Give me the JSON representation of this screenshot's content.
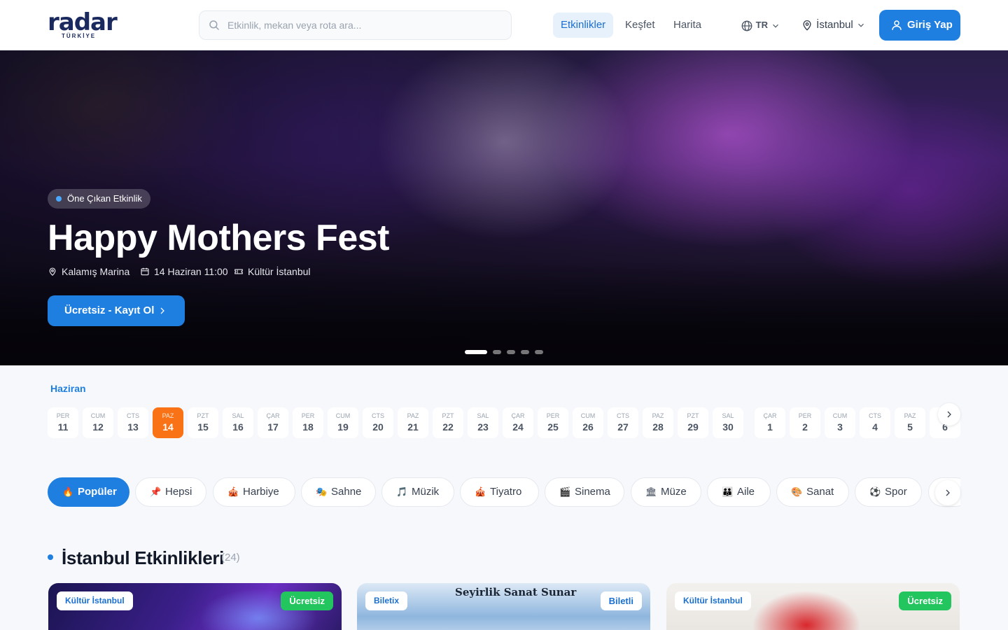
{
  "header": {
    "logo": {
      "word": "radar",
      "sub": "TÜRKİYE"
    },
    "search": {
      "placeholder": "Etkinlik, mekan veya rota ara..."
    },
    "nav": [
      {
        "label": "Etkinlikler",
        "active": true
      },
      {
        "label": "Keşfet",
        "active": false
      },
      {
        "label": "Harita",
        "active": false
      }
    ],
    "lang": "TR",
    "city": "İstanbul",
    "login_label": "Giriş Yap"
  },
  "hero": {
    "badge": "Öne Çıkan Etkinlik",
    "title": "Happy Mothers Fest",
    "venue": "Kalamış Marina",
    "datetime": "14 Haziran 11:00",
    "organizer": "Kültür İstanbul",
    "cta_label": "Ücretsiz - Kayıt Ol",
    "slides_total": 5,
    "slide_active": 1
  },
  "calendar": {
    "month": "Haziran",
    "selected_index": 3,
    "days": [
      {
        "dn": "PER",
        "dd": "11"
      },
      {
        "dn": "CUM",
        "dd": "12"
      },
      {
        "dn": "CTS",
        "dd": "13"
      },
      {
        "dn": "PAZ",
        "dd": "14"
      },
      {
        "dn": "PZT",
        "dd": "15"
      },
      {
        "dn": "SAL",
        "dd": "16"
      },
      {
        "dn": "ÇAR",
        "dd": "17"
      },
      {
        "dn": "PER",
        "dd": "18"
      },
      {
        "dn": "CUM",
        "dd": "19"
      },
      {
        "dn": "CTS",
        "dd": "20"
      },
      {
        "dn": "PAZ",
        "dd": "21"
      },
      {
        "dn": "PZT",
        "dd": "22"
      },
      {
        "dn": "SAL",
        "dd": "23"
      },
      {
        "dn": "ÇAR",
        "dd": "24"
      },
      {
        "dn": "PER",
        "dd": "25"
      },
      {
        "dn": "CUM",
        "dd": "26"
      },
      {
        "dn": "CTS",
        "dd": "27"
      },
      {
        "dn": "PAZ",
        "dd": "28"
      },
      {
        "dn": "PZT",
        "dd": "29"
      },
      {
        "dn": "SAL",
        "dd": "30"
      },
      {
        "dn": "ÇAR",
        "dd": "1"
      },
      {
        "dn": "PER",
        "dd": "2"
      },
      {
        "dn": "CUM",
        "dd": "3"
      },
      {
        "dn": "CTS",
        "dd": "4"
      },
      {
        "dn": "PAZ",
        "dd": "5"
      },
      {
        "dn": "PZT",
        "dd": "6"
      }
    ]
  },
  "categories": [
    {
      "emoji": "🔥",
      "label": "Popüler",
      "active": true
    },
    {
      "emoji": "📌",
      "label": "Hepsi",
      "active": false
    },
    {
      "emoji": "🎪",
      "label": "Harbiye",
      "active": false
    },
    {
      "emoji": "🎭",
      "label": "Sahne",
      "active": false
    },
    {
      "emoji": "🎵",
      "label": "Müzik",
      "active": false
    },
    {
      "emoji": "🎪",
      "label": "Tiyatro",
      "active": false
    },
    {
      "emoji": "🎬",
      "label": "Sinema",
      "active": false
    },
    {
      "emoji": "🏛",
      "label": "Müze",
      "active": false
    },
    {
      "emoji": "👪",
      "label": "Aile",
      "active": false
    },
    {
      "emoji": "🎨",
      "label": "Sanat",
      "active": false
    },
    {
      "emoji": "⚽",
      "label": "Spor",
      "active": false
    }
  ],
  "section": {
    "title": "İstanbul Etkinlikleri",
    "count": "(24)"
  },
  "cards": [
    {
      "source": "Kültür İstanbul",
      "price": "Ücretsiz",
      "free": true
    },
    {
      "source": "Biletix",
      "price": "Biletli",
      "free": false,
      "banner": "Seyirlik Sanat Sunar"
    },
    {
      "source": "Kültür İstanbul",
      "price": "Ücretsiz",
      "free": true
    }
  ],
  "colors": {
    "accent": "#1f7fe0",
    "selected_day": "#f97316",
    "free_badge": "#22c55e",
    "brand": "#1a2a5e"
  }
}
